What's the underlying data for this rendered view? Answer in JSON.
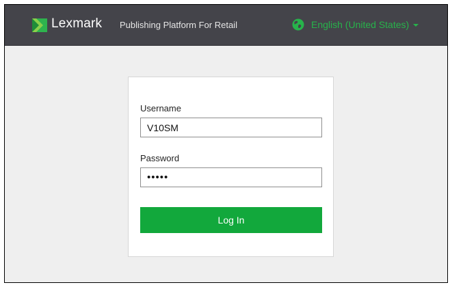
{
  "header": {
    "brand": "Lexmark",
    "platform": "Publishing Platform For Retail",
    "language": "English (United States)",
    "icons": {
      "logo": "lexmark-logo-icon",
      "language": "globe-icon",
      "dropdown": "caret-down-icon"
    },
    "colors": {
      "header_bg": "#44444a",
      "accent": "#27b34b"
    }
  },
  "login": {
    "username_label": "Username",
    "username_value": "V10SM",
    "password_label": "Password",
    "password_value": "•••••",
    "submit_label": "Log In",
    "button_color": "#12a83c"
  }
}
